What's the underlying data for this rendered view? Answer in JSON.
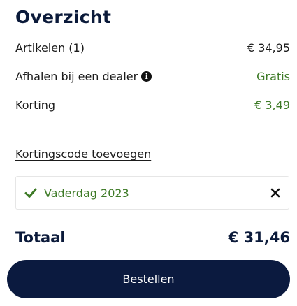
{
  "summary": {
    "title": "Overzicht",
    "rows": [
      {
        "label": "Artikelen (1)",
        "value": "€ 34,95"
      },
      {
        "label": "Afhalen bij een dealer",
        "value": "Gratis"
      },
      {
        "label": "Korting",
        "value": "€ 3,49"
      }
    ],
    "discount_link": "Kortingscode toevoegen",
    "voucher": {
      "name": "Vaderdag 2023"
    },
    "total": {
      "label": "Totaal",
      "value": "€ 31,46"
    },
    "order_button": "Bestellen"
  },
  "icons": {
    "info": "info-icon",
    "check": "check-icon",
    "close": "close-icon"
  },
  "colors": {
    "primary": "#0b1a3f",
    "discount_green": "#3d7a26",
    "text": "#1b1b1b"
  }
}
